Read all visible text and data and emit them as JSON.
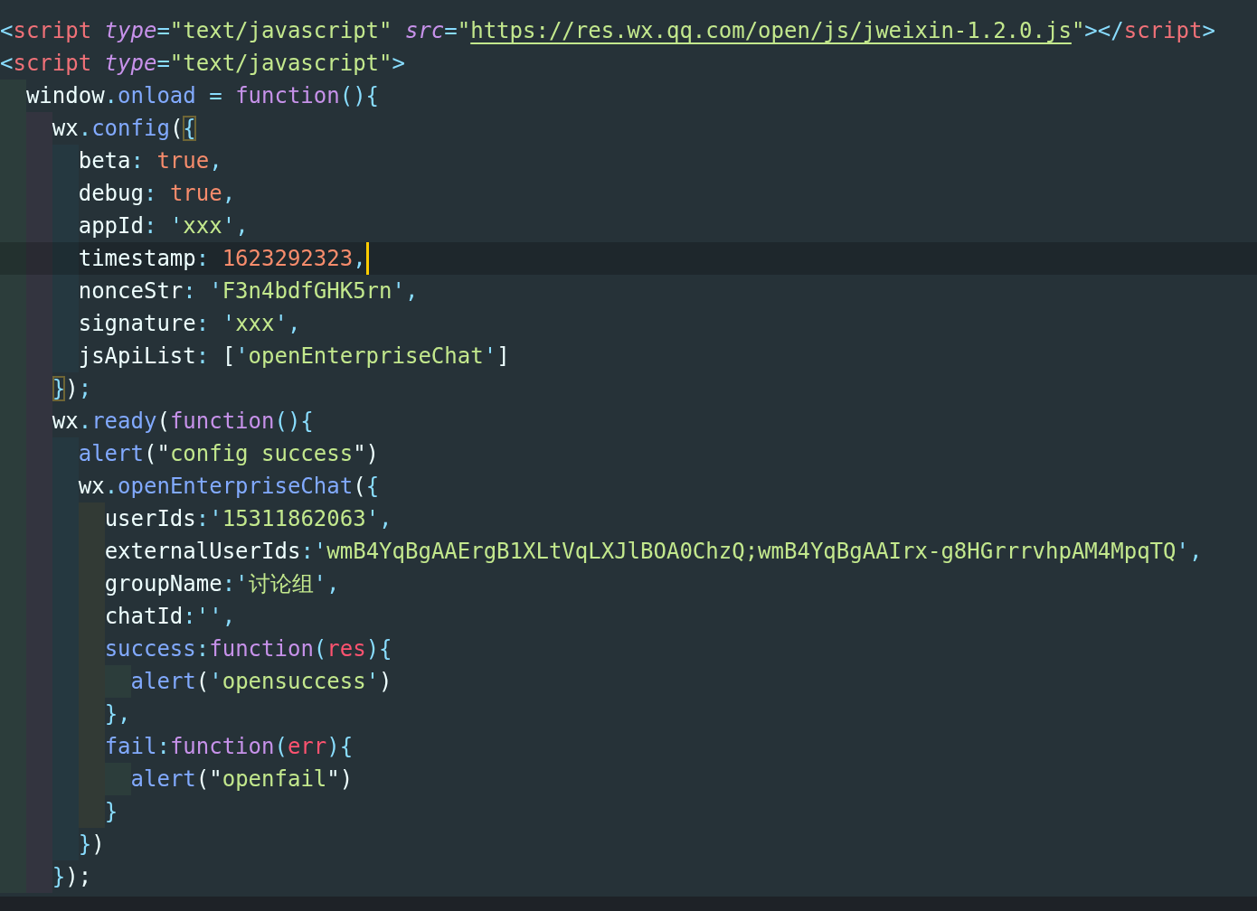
{
  "editor": {
    "lines": [
      {
        "current": false,
        "tokens": [
          {
            "kind": "punct",
            "text": "<"
          },
          {
            "kind": "tag",
            "text": "script"
          },
          {
            "kind": "attr",
            "text": " type"
          },
          {
            "kind": "punct",
            "text": "="
          },
          {
            "kind": "string",
            "text": "\"text/javascript\""
          },
          {
            "kind": "attr",
            "text": " src"
          },
          {
            "kind": "punct",
            "text": "="
          },
          {
            "kind": "string",
            "text": "\""
          },
          {
            "kind": "link",
            "text": "https://res.wx.qq.com/open/js/jweixin-1.2.0.js"
          },
          {
            "kind": "string",
            "text": "\""
          },
          {
            "kind": "punct",
            "text": "></"
          },
          {
            "kind": "tag",
            "text": "script"
          },
          {
            "kind": "punct",
            "text": ">"
          }
        ]
      },
      {
        "current": false,
        "tokens": [
          {
            "kind": "punct",
            "text": "<"
          },
          {
            "kind": "tag",
            "text": "script"
          },
          {
            "kind": "attr",
            "text": " type"
          },
          {
            "kind": "punct",
            "text": "="
          },
          {
            "kind": "string",
            "text": "\"text/javascript\""
          },
          {
            "kind": "punct",
            "text": ">"
          }
        ]
      },
      {
        "current": false,
        "tokens": [
          {
            "kind": "plain",
            "text": "  window"
          },
          {
            "kind": "punct",
            "text": "."
          },
          {
            "kind": "prop",
            "text": "onload"
          },
          {
            "kind": "punct",
            "text": " = "
          },
          {
            "kind": "keyword",
            "text": "function"
          },
          {
            "kind": "punct",
            "text": "(){"
          }
        ]
      },
      {
        "current": false,
        "tokens": [
          {
            "kind": "plain",
            "text": "    wx"
          },
          {
            "kind": "punct",
            "text": "."
          },
          {
            "kind": "prop",
            "text": "config"
          },
          {
            "kind": "plain",
            "text": "("
          },
          {
            "kind": "bracket",
            "text": "{"
          }
        ]
      },
      {
        "current": false,
        "tokens": [
          {
            "kind": "plain",
            "text": "      beta"
          },
          {
            "kind": "punct",
            "text": ": "
          },
          {
            "kind": "literal",
            "text": "true"
          },
          {
            "kind": "punct",
            "text": ","
          }
        ]
      },
      {
        "current": false,
        "tokens": [
          {
            "kind": "plain",
            "text": "      debug"
          },
          {
            "kind": "punct",
            "text": ": "
          },
          {
            "kind": "literal",
            "text": "true"
          },
          {
            "kind": "punct",
            "text": ","
          }
        ]
      },
      {
        "current": false,
        "tokens": [
          {
            "kind": "plain",
            "text": "      appId"
          },
          {
            "kind": "punct",
            "text": ": '"
          },
          {
            "kind": "string",
            "text": "xxx"
          },
          {
            "kind": "punct",
            "text": "',"
          }
        ]
      },
      {
        "current": true,
        "tokens": [
          {
            "kind": "plain",
            "text": "      timestamp"
          },
          {
            "kind": "punct",
            "text": ": "
          },
          {
            "kind": "literal",
            "text": "1623292323"
          },
          {
            "kind": "punct",
            "text": ","
          }
        ]
      },
      {
        "current": false,
        "tokens": [
          {
            "kind": "plain",
            "text": "      nonceStr"
          },
          {
            "kind": "punct",
            "text": ": '"
          },
          {
            "kind": "string",
            "text": "F3n4bdfGHK5rn"
          },
          {
            "kind": "punct",
            "text": "',"
          }
        ]
      },
      {
        "current": false,
        "tokens": [
          {
            "kind": "plain",
            "text": "      signature"
          },
          {
            "kind": "punct",
            "text": ": '"
          },
          {
            "kind": "string",
            "text": "xxx"
          },
          {
            "kind": "punct",
            "text": "',"
          }
        ]
      },
      {
        "current": false,
        "tokens": [
          {
            "kind": "plain",
            "text": "      jsApiList"
          },
          {
            "kind": "punct",
            "text": ": "
          },
          {
            "kind": "plain",
            "text": "["
          },
          {
            "kind": "punct",
            "text": "'"
          },
          {
            "kind": "string",
            "text": "openEnterpriseChat"
          },
          {
            "kind": "punct",
            "text": "'"
          },
          {
            "kind": "plain",
            "text": "]"
          }
        ]
      },
      {
        "current": false,
        "tokens": [
          {
            "kind": "bracket",
            "text": "    }"
          },
          {
            "kind": "plain",
            "text": ")"
          },
          {
            "kind": "punct",
            "text": ";"
          }
        ]
      },
      {
        "current": false,
        "tokens": [
          {
            "kind": "plain",
            "text": "    wx"
          },
          {
            "kind": "punct",
            "text": "."
          },
          {
            "kind": "prop",
            "text": "ready"
          },
          {
            "kind": "plain",
            "text": "("
          },
          {
            "kind": "keyword",
            "text": "function"
          },
          {
            "kind": "punct",
            "text": "(){"
          }
        ]
      },
      {
        "current": false,
        "tokens": [
          {
            "kind": "prop",
            "text": "      alert"
          },
          {
            "kind": "plain",
            "text": "(\""
          },
          {
            "kind": "string",
            "text": "config success"
          },
          {
            "kind": "plain",
            "text": "\")"
          }
        ]
      },
      {
        "current": false,
        "tokens": [
          {
            "kind": "plain",
            "text": "      wx"
          },
          {
            "kind": "punct",
            "text": "."
          },
          {
            "kind": "prop",
            "text": "openEnterpriseChat"
          },
          {
            "kind": "plain",
            "text": "("
          },
          {
            "kind": "punct",
            "text": "{"
          }
        ]
      },
      {
        "current": false,
        "tokens": [
          {
            "kind": "plain",
            "text": "        userIds"
          },
          {
            "kind": "punct",
            "text": ":'"
          },
          {
            "kind": "string",
            "text": "15311862063"
          },
          {
            "kind": "punct",
            "text": "',"
          }
        ]
      },
      {
        "current": false,
        "tokens": [
          {
            "kind": "plain",
            "text": "        externalUserIds"
          },
          {
            "kind": "punct",
            "text": ":'"
          },
          {
            "kind": "string",
            "text": "wmB4YqBgAAErgB1XLtVqLXJlBOA0ChzQ;wmB4YqBgAAIrx-g8HGrrrvhpAM4MpqTQ"
          },
          {
            "kind": "punct",
            "text": "',"
          }
        ]
      },
      {
        "current": false,
        "tokens": [
          {
            "kind": "plain",
            "text": "        groupName"
          },
          {
            "kind": "punct",
            "text": ":'"
          },
          {
            "kind": "string",
            "text": "讨论组"
          },
          {
            "kind": "punct",
            "text": "',"
          }
        ]
      },
      {
        "current": false,
        "tokens": [
          {
            "kind": "plain",
            "text": "        chatId"
          },
          {
            "kind": "punct",
            "text": ":'',"
          }
        ]
      },
      {
        "current": false,
        "tokens": [
          {
            "kind": "prop",
            "text": "        success"
          },
          {
            "kind": "punct",
            "text": ":"
          },
          {
            "kind": "keyword",
            "text": "function"
          },
          {
            "kind": "punct",
            "text": "("
          },
          {
            "kind": "param",
            "text": "res"
          },
          {
            "kind": "punct",
            "text": "){"
          }
        ]
      },
      {
        "current": false,
        "tokens": [
          {
            "kind": "prop",
            "text": "          alert"
          },
          {
            "kind": "plain",
            "text": "("
          },
          {
            "kind": "punct",
            "text": "'"
          },
          {
            "kind": "string",
            "text": "opensuccess"
          },
          {
            "kind": "punct",
            "text": "'"
          },
          {
            "kind": "plain",
            "text": ")"
          }
        ]
      },
      {
        "current": false,
        "tokens": [
          {
            "kind": "punct",
            "text": "        },"
          }
        ]
      },
      {
        "current": false,
        "tokens": [
          {
            "kind": "prop",
            "text": "        fail"
          },
          {
            "kind": "punct",
            "text": ":"
          },
          {
            "kind": "keyword",
            "text": "function"
          },
          {
            "kind": "punct",
            "text": "("
          },
          {
            "kind": "param",
            "text": "err"
          },
          {
            "kind": "punct",
            "text": "){"
          }
        ]
      },
      {
        "current": false,
        "tokens": [
          {
            "kind": "prop",
            "text": "          alert"
          },
          {
            "kind": "plain",
            "text": "(\""
          },
          {
            "kind": "string",
            "text": "openfail"
          },
          {
            "kind": "plain",
            "text": "\")"
          }
        ]
      },
      {
        "current": false,
        "tokens": [
          {
            "kind": "punct",
            "text": "        }"
          }
        ]
      },
      {
        "current": false,
        "tokens": [
          {
            "kind": "punct",
            "text": "      }"
          },
          {
            "kind": "plain",
            "text": ")"
          }
        ]
      },
      {
        "current": false,
        "tokens": [
          {
            "kind": "punct",
            "text": "    }"
          },
          {
            "kind": "plain",
            "text": ");"
          }
        ]
      }
    ]
  }
}
